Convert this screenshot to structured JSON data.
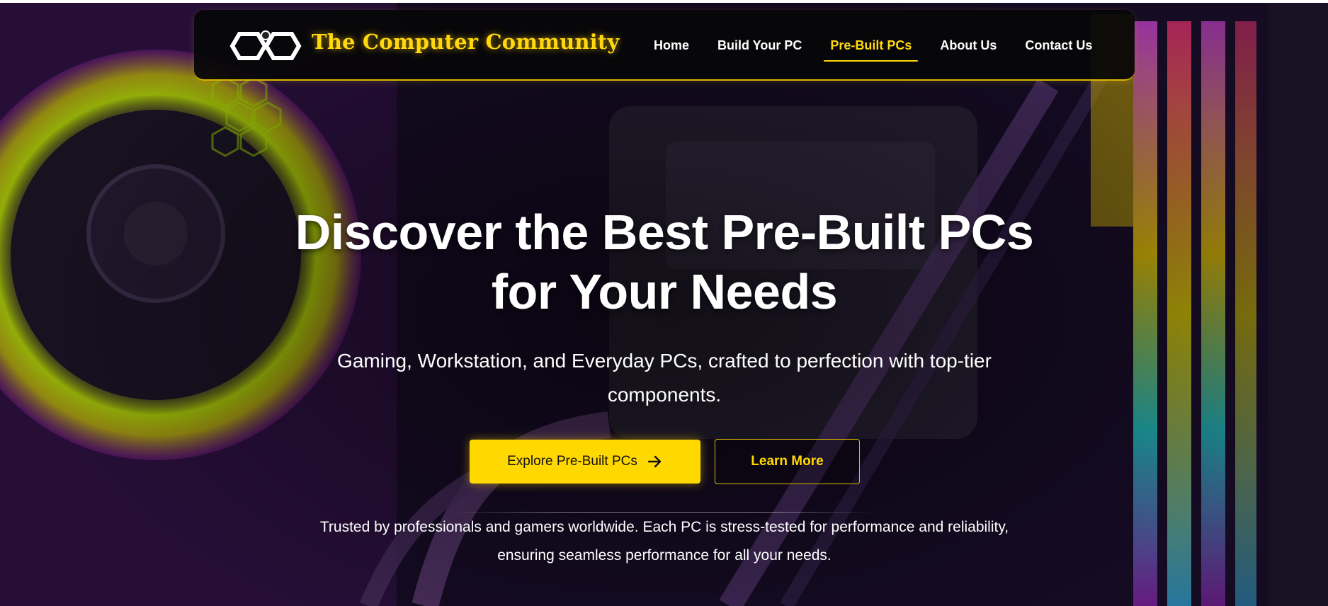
{
  "brand": {
    "name": "The Computer Community",
    "logo_icon": "hexagon-link-logo-icon",
    "color": "#ffd80f"
  },
  "nav": {
    "items": [
      {
        "label": "Home",
        "active": false
      },
      {
        "label": "Build Your PC",
        "active": false
      },
      {
        "label": "Pre-Built PCs",
        "active": true
      },
      {
        "label": "About Us",
        "active": false
      },
      {
        "label": "Contact Us",
        "active": false
      }
    ],
    "active_color": "#ffd80f"
  },
  "hero": {
    "headline_line1": "Discover the Best Pre-Built PCs",
    "headline_line2": "for Your Needs",
    "subtitle": "Gaming, Workstation, and Everyday PCs, crafted to perfection with top-tier components.",
    "primary_button": {
      "label": "Explore Pre-Built PCs",
      "icon": "arrow-right-icon"
    },
    "secondary_button": {
      "label": "Learn More"
    },
    "trust_text": "Trusted by professionals and gamers worldwide. Each PC is stress-tested for performance and reliability, ensuring seamless performance for all your needs."
  },
  "colors": {
    "accent": "#ffd800",
    "background": "#0d0818"
  }
}
